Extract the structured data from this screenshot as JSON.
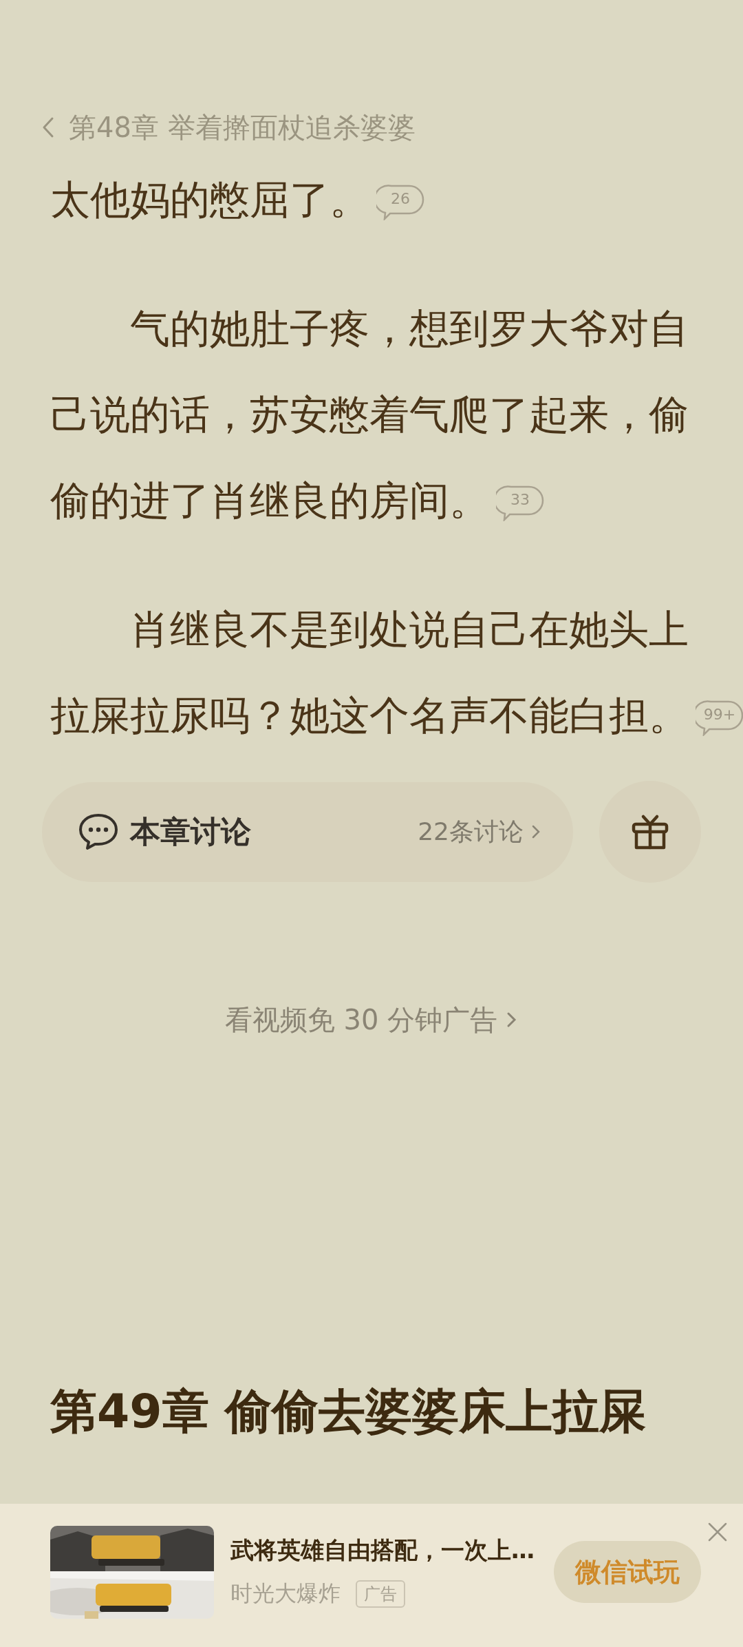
{
  "header": {
    "chapter_title": "第48章 举着擀面杖追杀婆婆"
  },
  "paragraphs": [
    {
      "text": "太他妈的憋屈了。",
      "comments": "26",
      "indent": false
    },
    {
      "text": "气的她肚子疼，想到罗大爷对自己说的话，苏安憋着气爬了起来，偷偷的进了肖继良的房间。",
      "comments": "33",
      "indent": true
    },
    {
      "text": "肖继良不是到处说自己在她头上拉屎拉尿吗？她这个名声不能白担。",
      "comments": "99+",
      "indent": true
    }
  ],
  "discussion": {
    "title": "本章讨论",
    "count": "22条讨论"
  },
  "ad_free_link": "看视频免 30 分钟广告",
  "next_chapter_title": "第49章 偷偷去婆婆床上拉屎",
  "ad": {
    "title": "武将英雄自由搭配，一次上…",
    "source": "时光大爆炸",
    "tag": "广告",
    "button": "微信试玩"
  }
}
